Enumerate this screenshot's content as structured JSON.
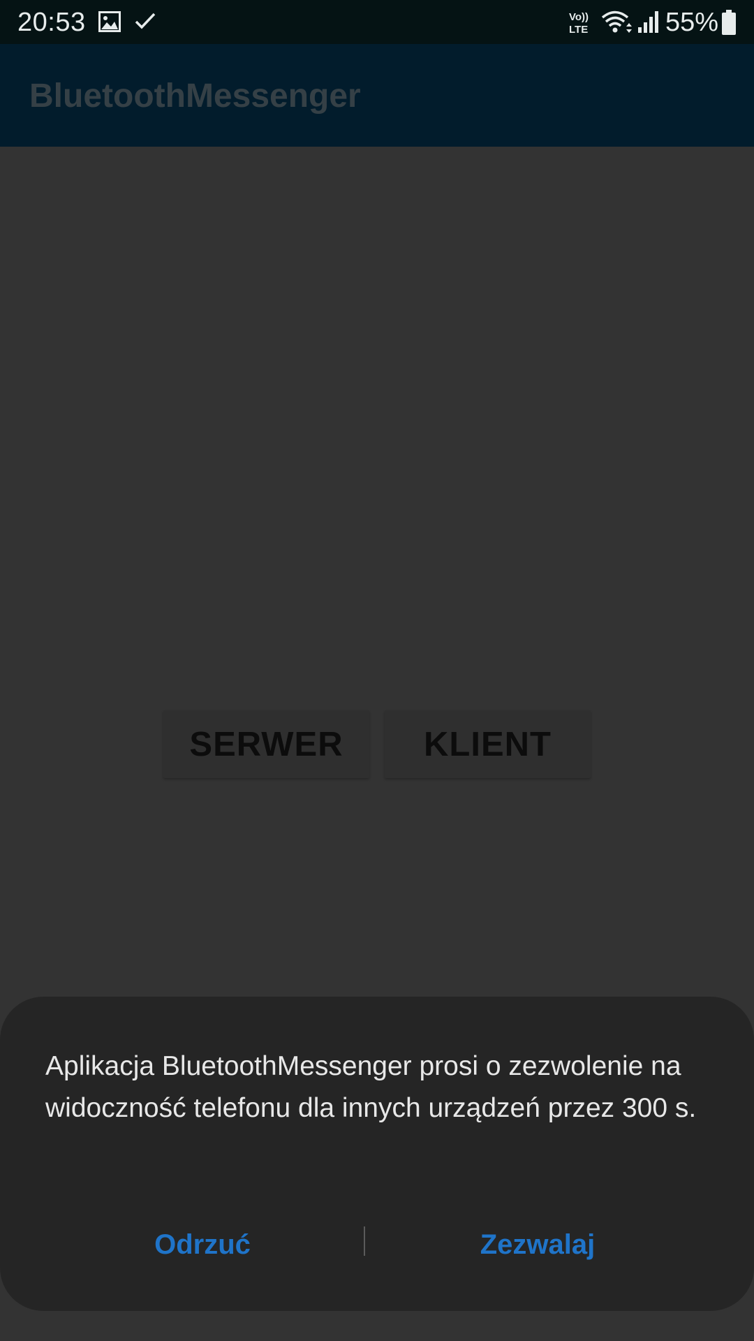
{
  "status_bar": {
    "time": "20:53",
    "battery_percent": "55%",
    "icons": [
      "image-icon",
      "check-icon",
      "volte-icon",
      "wifi-icon",
      "signal-icon",
      "battery-icon"
    ]
  },
  "app_bar": {
    "title": "BluetoothMessenger"
  },
  "main": {
    "server_button": "SERWER",
    "client_button": "KLIENT"
  },
  "dialog": {
    "message": "Aplikacja BluetoothMessenger prosi o zezwolenie na widoczność telefonu dla innych urządzeń przez 300 s.",
    "deny_label": "Odrzuć",
    "allow_label": "Zezwalaj"
  },
  "colors": {
    "status_bar_bg": "#051314",
    "app_bar_bg": "#021c2c",
    "content_bg": "#333333",
    "dialog_bg": "#252525",
    "dialog_button_text": "#1f74c9"
  }
}
